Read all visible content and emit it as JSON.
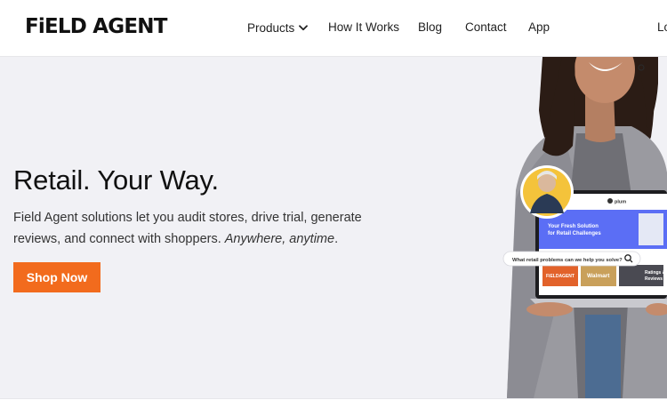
{
  "header": {
    "logo_text": "FiELD AGENT",
    "nav": {
      "products": "Products",
      "how_it_works": "How It Works",
      "blog": "Blog",
      "contact": "Contact",
      "app": "App",
      "login_partial": "Lo"
    }
  },
  "hero": {
    "headline": "Retail. Your Way.",
    "subtext": "Field Agent solutions let you audit stores, drive trial, generate reviews, and connect with shoppers. ",
    "subtext_italic": "Anywhere, anytime",
    "subtext_end": ".",
    "cta_label": "Shop Now"
  },
  "laptop_screen": {
    "brand": "plum",
    "banner": "Your Fresh Solution for Retail Challenges",
    "search_placeholder": "What retail problems can we help you solve?",
    "card1": "FiELDAGENT",
    "card2": "Walmart",
    "card3": "Ratings & Reviews"
  },
  "colors": {
    "accent": "#f26b1d",
    "hero_bg": "#f1f1f5",
    "screen_blue": "#5b6ef5"
  }
}
